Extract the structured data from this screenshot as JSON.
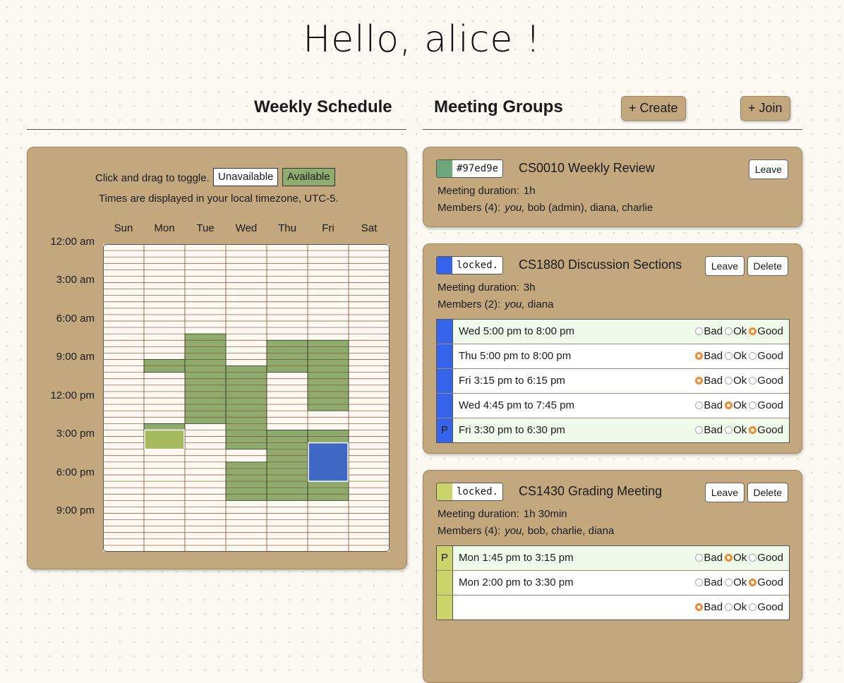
{
  "greeting": "Hello, alice !",
  "schedule": {
    "title": "Weekly Schedule",
    "hint": "Click and drag to toggle.",
    "legend_unavailable": "Unavailable",
    "legend_available": "Available",
    "timezone_note": "Times are displayed in your local timezone, UTC-5.",
    "days": [
      "Sun",
      "Mon",
      "Tue",
      "Wed",
      "Thu",
      "Fri",
      "Sat"
    ],
    "time_labels": [
      "12:00 am",
      "3:00 am",
      "6:00 am",
      "9:00 am",
      "12:00 pm",
      "3:00 pm",
      "6:00 pm",
      "9:00 pm"
    ],
    "colors": {
      "available": "#8fac6f",
      "drag": "#a6b95c",
      "blue": "#3e68c3",
      "border": "#8b4a2b",
      "cell": "#fcf9f3"
    },
    "available_blocks": [
      {
        "day": "Mon",
        "start": "9:00 am",
        "end": "10:00 am"
      },
      {
        "day": "Mon",
        "start": "2:00 pm",
        "end": "4:00 pm"
      },
      {
        "day": "Tue",
        "start": "7:00 am",
        "end": "2:00 pm"
      },
      {
        "day": "Wed",
        "start": "9:30 am",
        "end": "4:00 pm"
      },
      {
        "day": "Wed",
        "start": "5:00 pm",
        "end": "8:00 pm"
      },
      {
        "day": "Thu",
        "start": "7:30 am",
        "end": "10:00 am"
      },
      {
        "day": "Thu",
        "start": "2:30 pm",
        "end": "8:00 pm"
      },
      {
        "day": "Fri",
        "start": "7:30 am",
        "end": "1:00 pm"
      },
      {
        "day": "Fri",
        "start": "2:30 pm",
        "end": "8:00 pm"
      }
    ],
    "drag_selection": {
      "day": "Mon",
      "start": "2:30 pm",
      "end": "4:00 pm"
    },
    "highlight_block": {
      "day": "Fri",
      "start": "3:30 pm",
      "end": "6:30 pm"
    }
  },
  "groups_header": {
    "title": "Meeting Groups",
    "create_label": "+ Create",
    "join_label": "+ Join"
  },
  "duration_label": "Meeting duration:",
  "labels": {
    "bad": "Bad",
    "ok": "Ok",
    "good": "Good"
  },
  "groups": [
    {
      "code": "#97ed9e",
      "color": "#6da87a",
      "name": "CS0010 Weekly Review",
      "leave_label": "Leave",
      "delete_label": "",
      "duration": "1h",
      "members_label": "Members (4):",
      "members_you": "you,",
      "members_rest": " bob (admin), diana, charlie",
      "slots": []
    },
    {
      "code": "locked.",
      "color": "#3563e9",
      "name": "CS1880 Discussion Sections",
      "leave_label": "Leave",
      "delete_label": "Delete",
      "duration": "3h",
      "members_label": "Members (2):",
      "members_you": "you,",
      "members_rest": " diana",
      "slots": [
        {
          "when": "Wed 5:00 pm to 8:00 pm",
          "rating": "good",
          "marker": "",
          "pref": true
        },
        {
          "when": "Thu 5:00 pm to 8:00 pm",
          "rating": "bad",
          "marker": "",
          "pref": false
        },
        {
          "when": "Fri 3:15 pm to 6:15 pm",
          "rating": "bad",
          "marker": "",
          "pref": false
        },
        {
          "when": "Wed 4:45 pm to 7:45 pm",
          "rating": "ok",
          "marker": "",
          "pref": false
        },
        {
          "when": "Fri 3:30 pm to 6:30 pm",
          "rating": "good",
          "marker": "P",
          "pref": true
        }
      ]
    },
    {
      "code": "locked.",
      "color": "#ccd36a",
      "name": "CS1430 Grading Meeting",
      "leave_label": "Leave",
      "delete_label": "Delete",
      "duration": "1h 30min",
      "members_label": "Members (4):",
      "members_you": "you,",
      "members_rest": " bob, charlie, diana",
      "slots": [
        {
          "when": "Mon 1:45 pm to 3:15 pm",
          "rating": "ok",
          "marker": "P",
          "pref": true
        },
        {
          "when": "Mon 2:00 pm to 3:30 pm",
          "rating": "good",
          "marker": "",
          "pref": false
        },
        {
          "when": "",
          "rating": "bad",
          "marker": "",
          "pref": false
        }
      ]
    }
  ]
}
